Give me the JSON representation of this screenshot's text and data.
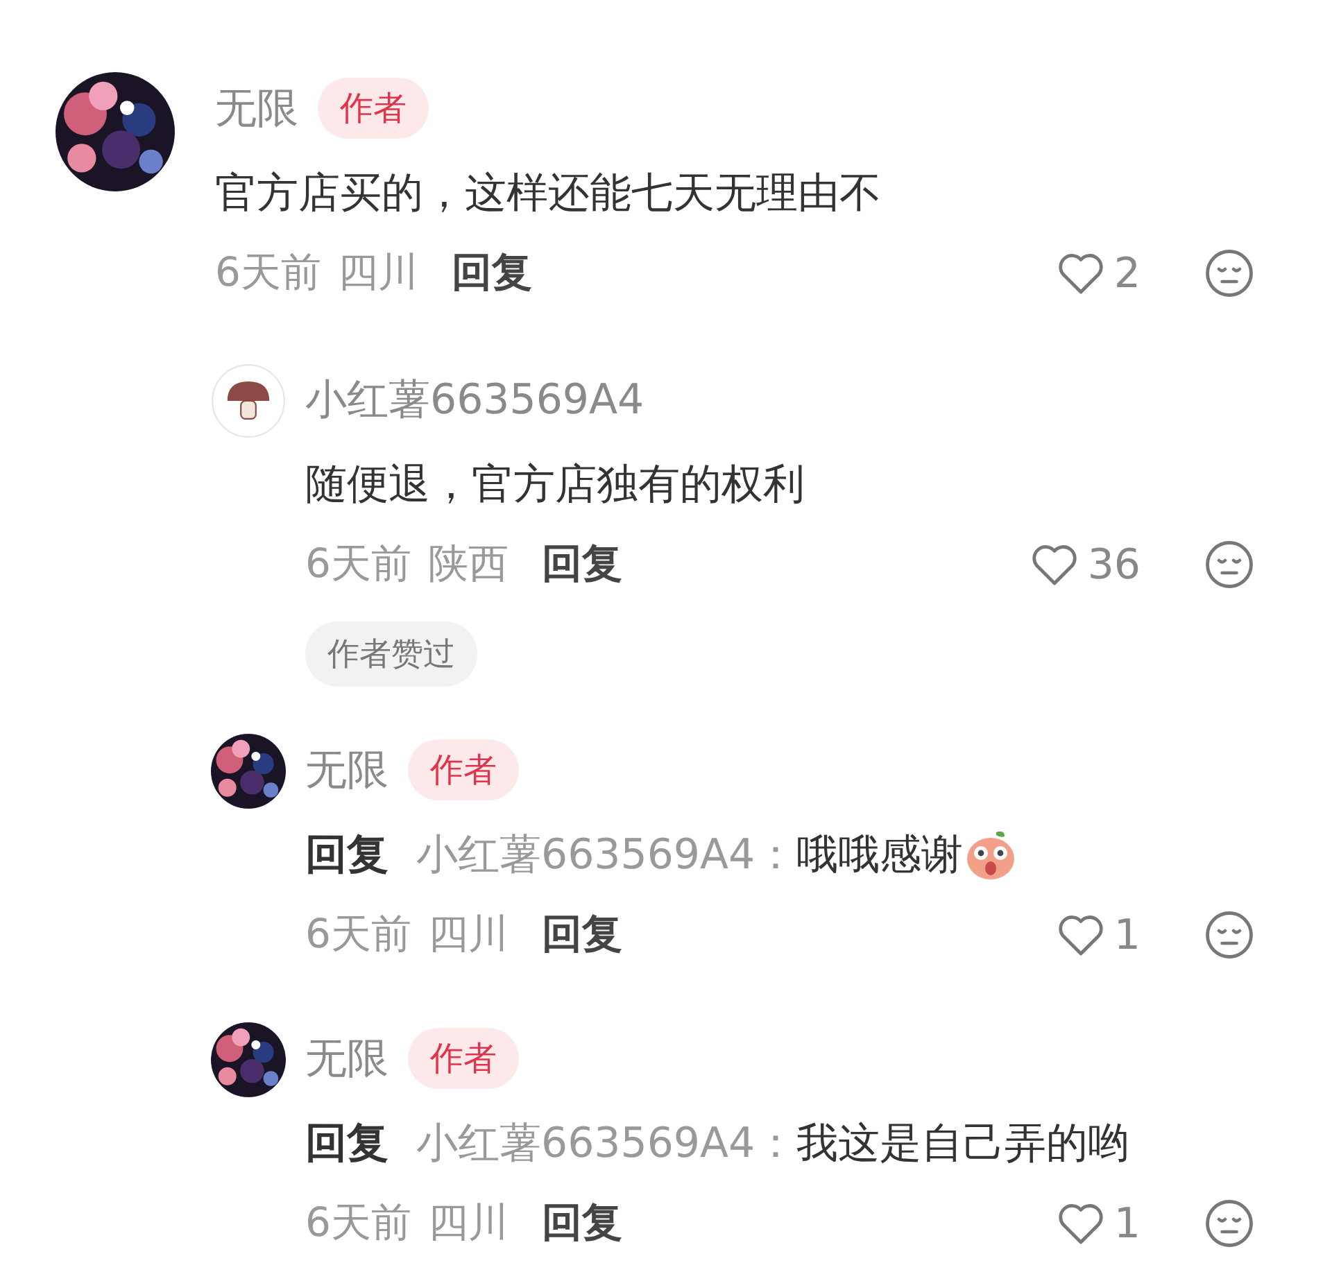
{
  "comments": [
    {
      "author": "无限",
      "badge": "作者",
      "text": "官方店买的，这样还能七天无理由不",
      "time": "6天前",
      "location": "四川",
      "reply_label": "回复",
      "likes": "2",
      "liked": false,
      "replies": [
        {
          "avatar": {
            "kind": "mushroom"
          },
          "author": "小红薯663569A4",
          "text": "随便退，官方店独有的权利",
          "time": "6天前",
          "location": "陕西",
          "reply_label": "回复",
          "likes": "36",
          "liked": false,
          "tag": "作者赞过"
        },
        {
          "author": "无限",
          "badge": "作者",
          "reply_prefix": "回复",
          "reply_to": "小红薯663569A4：",
          "text": "哦哦感谢",
          "emoji": true,
          "time": "6天前",
          "location": "四川",
          "reply_label": "回复",
          "likes": "1",
          "liked": false
        },
        {
          "author": "无限",
          "badge": "作者",
          "reply_prefix": "回复",
          "reply_to": "小红薯663569A4：",
          "text": "我这是自己弄的哟",
          "time": "6天前",
          "location": "四川",
          "reply_label": "回复",
          "likes": "1",
          "liked": false
        }
      ]
    }
  ]
}
